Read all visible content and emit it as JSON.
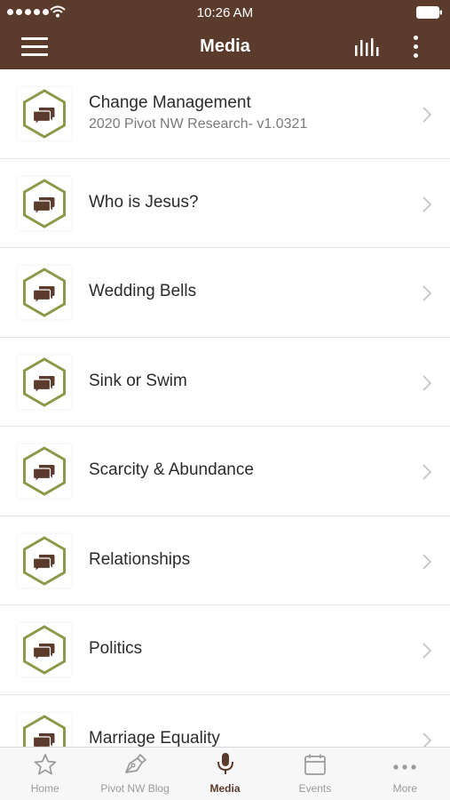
{
  "status_bar": {
    "time": "10:26 AM"
  },
  "header": {
    "title": "Media"
  },
  "items": [
    {
      "title": "Change Management",
      "subtitle": "2020 Pivot NW Research- v1.0321"
    },
    {
      "title": "Who is Jesus?",
      "subtitle": ""
    },
    {
      "title": "Wedding Bells",
      "subtitle": ""
    },
    {
      "title": "Sink or Swim",
      "subtitle": ""
    },
    {
      "title": "Scarcity & Abundance",
      "subtitle": ""
    },
    {
      "title": "Relationships",
      "subtitle": ""
    },
    {
      "title": "Politics",
      "subtitle": ""
    },
    {
      "title": "Marriage Equality",
      "subtitle": ""
    }
  ],
  "tabs": [
    {
      "label": "Home",
      "icon": "star-icon"
    },
    {
      "label": "Pivot NW Blog",
      "icon": "pen-icon"
    },
    {
      "label": "Media",
      "icon": "microphone-icon",
      "active": true
    },
    {
      "label": "Events",
      "icon": "calendar-icon"
    },
    {
      "label": "More",
      "icon": "ellipsis-icon"
    }
  ],
  "colors": {
    "brand": "#5b3b2b",
    "hexagon_outline": "#8a9a4a",
    "tab_inactive": "#9a9a9a"
  }
}
